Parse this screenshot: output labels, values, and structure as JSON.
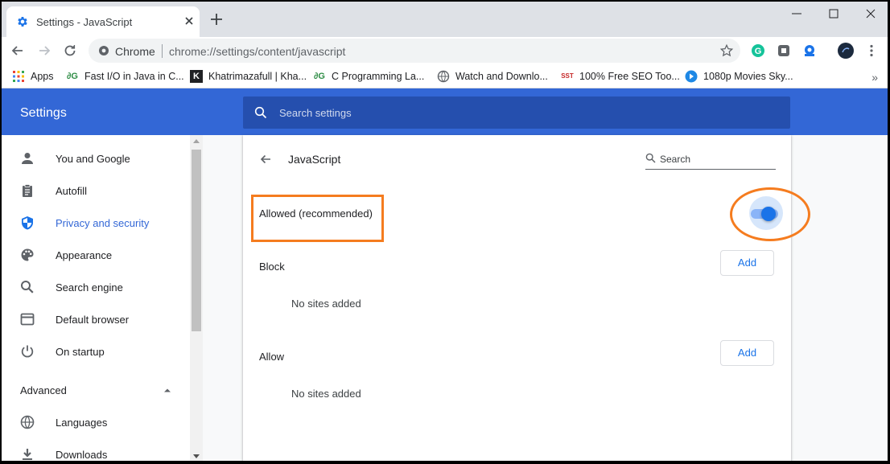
{
  "tab": {
    "title": "Settings - JavaScript"
  },
  "omnibox": {
    "site_label": "Chrome",
    "url": "chrome://settings/content/javascript"
  },
  "bookmarks": [
    {
      "label": "Apps",
      "icon": "apps-grid-icon"
    },
    {
      "label": "Fast I/O in Java in C...",
      "icon": "gfg-icon"
    },
    {
      "label": "Khatrimazafull | Kha...",
      "icon": "k-icon"
    },
    {
      "label": "C Programming La...",
      "icon": "gfg-icon"
    },
    {
      "label": "Watch and Downlo...",
      "icon": "globe-icon"
    },
    {
      "label": "100% Free SEO Too...",
      "icon": "sst-icon"
    },
    {
      "label": "1080p Movies Sky...",
      "icon": "play-icon"
    }
  ],
  "header": {
    "title": "Settings",
    "search_placeholder": "Search settings"
  },
  "sidebar": {
    "items": [
      {
        "label": "You and Google",
        "icon": "person-icon"
      },
      {
        "label": "Autofill",
        "icon": "clipboard-icon"
      },
      {
        "label": "Privacy and security",
        "icon": "shield-icon"
      },
      {
        "label": "Appearance",
        "icon": "palette-icon"
      },
      {
        "label": "Search engine",
        "icon": "search-icon"
      },
      {
        "label": "Default browser",
        "icon": "browser-icon"
      },
      {
        "label": "On startup",
        "icon": "power-icon"
      }
    ],
    "advanced_label": "Advanced",
    "advanced_items": [
      {
        "label": "Languages",
        "icon": "globe-icon"
      },
      {
        "label": "Downloads",
        "icon": "download-icon"
      }
    ]
  },
  "content": {
    "title": "JavaScript",
    "search_placeholder": "Search",
    "allowed_label": "Allowed (recommended)",
    "block": {
      "label": "Block",
      "button": "Add",
      "empty": "No sites added"
    },
    "allow": {
      "label": "Allow",
      "button": "Add",
      "empty": "No sites added"
    }
  },
  "colors": {
    "accent": "#3367d6",
    "link_blue": "#1a73e8",
    "highlight_orange": "#f57c1f"
  }
}
